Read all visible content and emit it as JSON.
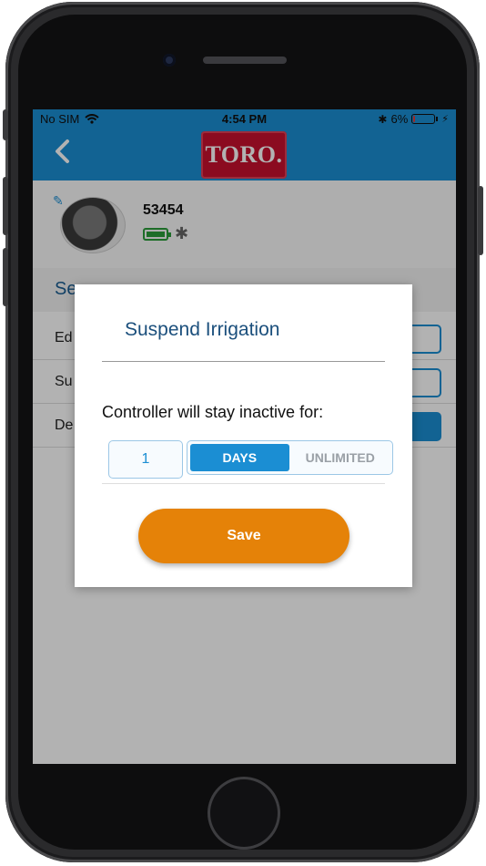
{
  "status_bar": {
    "carrier": "No SIM",
    "time": "4:54 PM",
    "battery_percent": "6%",
    "battery_level": 0.06
  },
  "nav": {
    "logo_text": "TORO."
  },
  "device": {
    "name": "53454"
  },
  "background": {
    "section_title": "Se",
    "rows": [
      {
        "label": "Ed"
      },
      {
        "label": "Su"
      },
      {
        "label": "De"
      }
    ]
  },
  "modal": {
    "title": "Suspend Irrigation",
    "message": "Controller will stay inactive for:",
    "quantity_value": "1",
    "options": [
      {
        "label": "DAYS",
        "selected": true
      },
      {
        "label": "UNLIMITED",
        "selected": false
      }
    ],
    "save_label": "Save"
  },
  "colors": {
    "accent_blue": "#1b8ed3",
    "toro_red": "#c8102e",
    "save_orange": "#e58208"
  }
}
